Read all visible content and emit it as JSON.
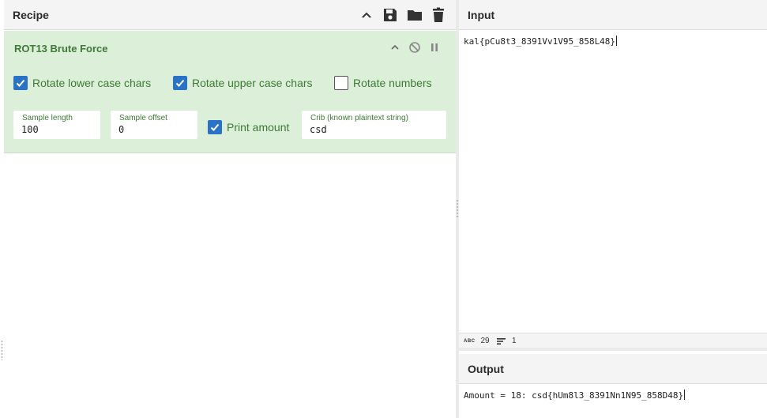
{
  "recipe": {
    "title": "Recipe"
  },
  "operation": {
    "title": "ROT13 Brute Force",
    "checkboxes": {
      "rotate_lower": {
        "label": "Rotate lower case chars",
        "checked": true
      },
      "rotate_upper": {
        "label": "Rotate upper case chars",
        "checked": true
      },
      "rotate_numbers": {
        "label": "Rotate numbers",
        "checked": false
      },
      "print_amount": {
        "label": "Print amount",
        "checked": true
      }
    },
    "fields": {
      "sample_length": {
        "label": "Sample length",
        "value": "100"
      },
      "sample_offset": {
        "label": "Sample offset",
        "value": "0"
      },
      "crib": {
        "label": "Crib (known plaintext string)",
        "value": "csd"
      }
    }
  },
  "input": {
    "title": "Input",
    "text": "kal{pCu8t3_8391Vv1V95_858L48}",
    "status": {
      "chars_badge": "ABC",
      "chars": "29",
      "lines": "1"
    }
  },
  "output": {
    "title": "Output",
    "text": "Amount = 18: csd{hUm8l3_8391Nn1N95_858D48}"
  },
  "colors": {
    "operation_bg": "#dcefd9",
    "operation_text": "#3d7a35",
    "checkbox_accent": "#2a72c8",
    "header_bg": "#f4f4f4"
  }
}
